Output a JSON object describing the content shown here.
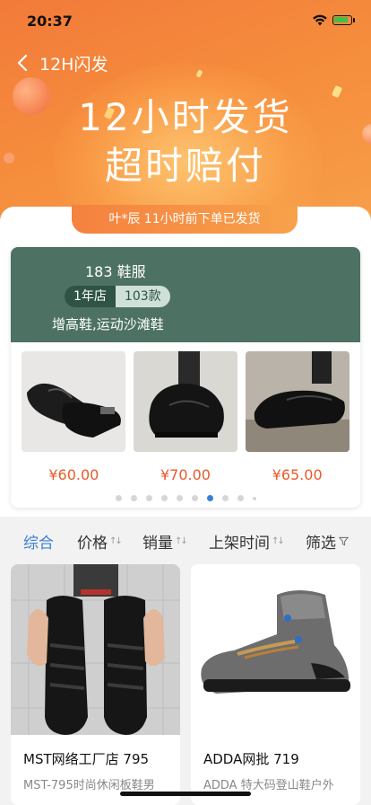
{
  "status_bar": {
    "time": "20:37"
  },
  "nav": {
    "title": "12H闪发"
  },
  "banner": {
    "line1": "12小时发货",
    "line2": "超时赔付"
  },
  "promo": {
    "text": "叶*辰 11小时前下单已发货"
  },
  "store": {
    "name": "183 鞋服",
    "years_tag": "1年店",
    "count_tag": "103款",
    "categories": "增高鞋,运动沙滩鞋",
    "products": [
      {
        "price": "¥60.00"
      },
      {
        "price": "¥70.00"
      },
      {
        "price": "¥65.00"
      }
    ],
    "carousel": {
      "total": 10,
      "active_index": 6
    }
  },
  "filters": [
    {
      "label": "综合",
      "active": true
    },
    {
      "label": "价格",
      "sortable": true
    },
    {
      "label": "销量",
      "sortable": true
    },
    {
      "label": "上架时间",
      "sortable": true
    },
    {
      "label": "筛选",
      "icon": "funnel-icon"
    }
  ],
  "items": [
    {
      "store": "MST网络工厂店 795",
      "desc": "MST-795时尚休闲板鞋男"
    },
    {
      "store": "ADDA网批 719",
      "desc": "ADDA 特大码登山鞋户外"
    }
  ],
  "colors": {
    "accent": "#3a7fd6",
    "price": "#e85a2a",
    "brand_orange": "#f58c3c",
    "store_green": "#4d7263"
  }
}
